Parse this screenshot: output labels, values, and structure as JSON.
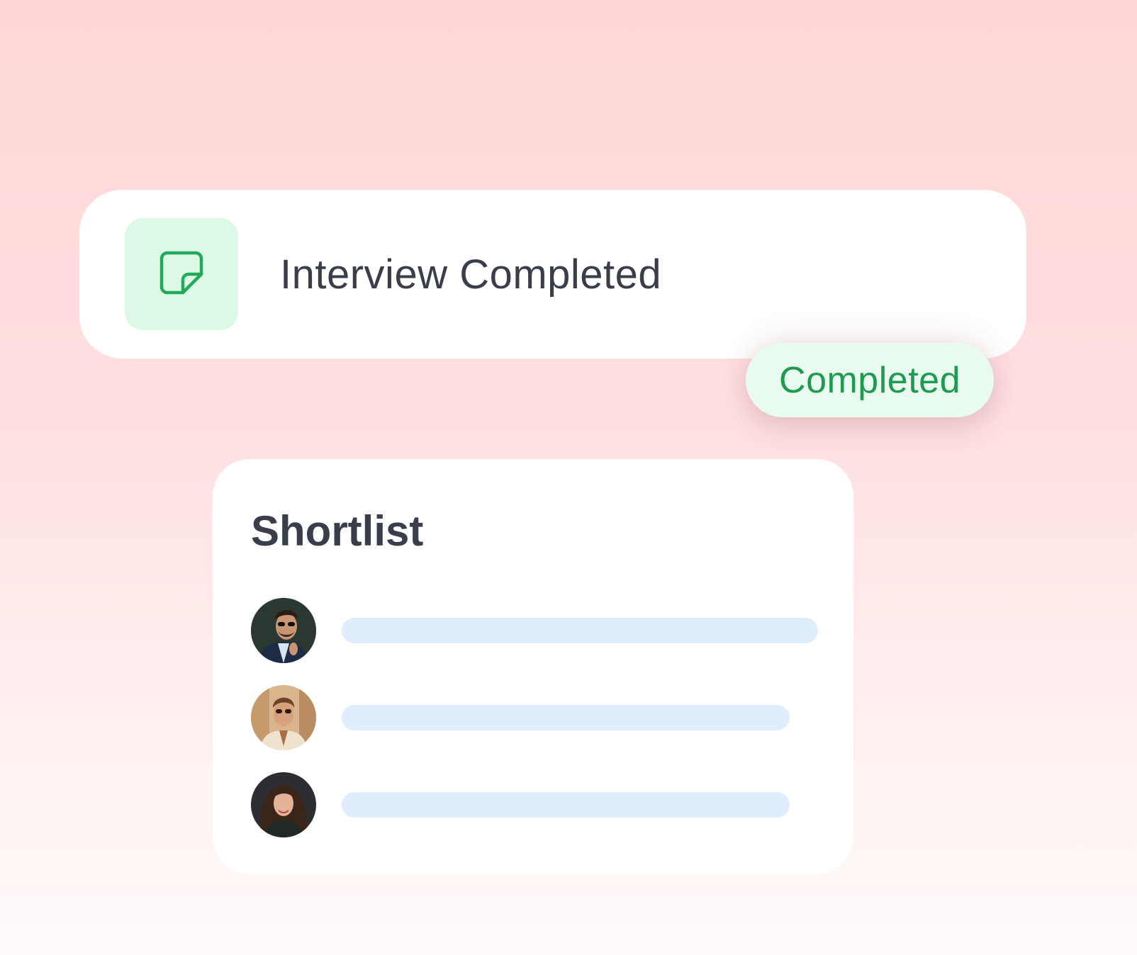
{
  "event": {
    "title": "Interview Completed",
    "icon": "sticky-note-icon",
    "icon_color": "#22a95a",
    "icon_bg": "#dcf9e6"
  },
  "status": {
    "label": "Completed",
    "color": "#1e9a52",
    "bg": "#e9fbef"
  },
  "shortlist": {
    "title": "Shortlist",
    "candidates": [
      {
        "avatar": "man-with-sunglasses-avatar",
        "bar_fill": 1.0
      },
      {
        "avatar": "man-with-glasses-avatar",
        "bar_fill": 0.94
      },
      {
        "avatar": "woman-with-long-hair-avatar",
        "bar_fill": 0.94
      }
    ],
    "bar_color": "#dfedfc"
  }
}
